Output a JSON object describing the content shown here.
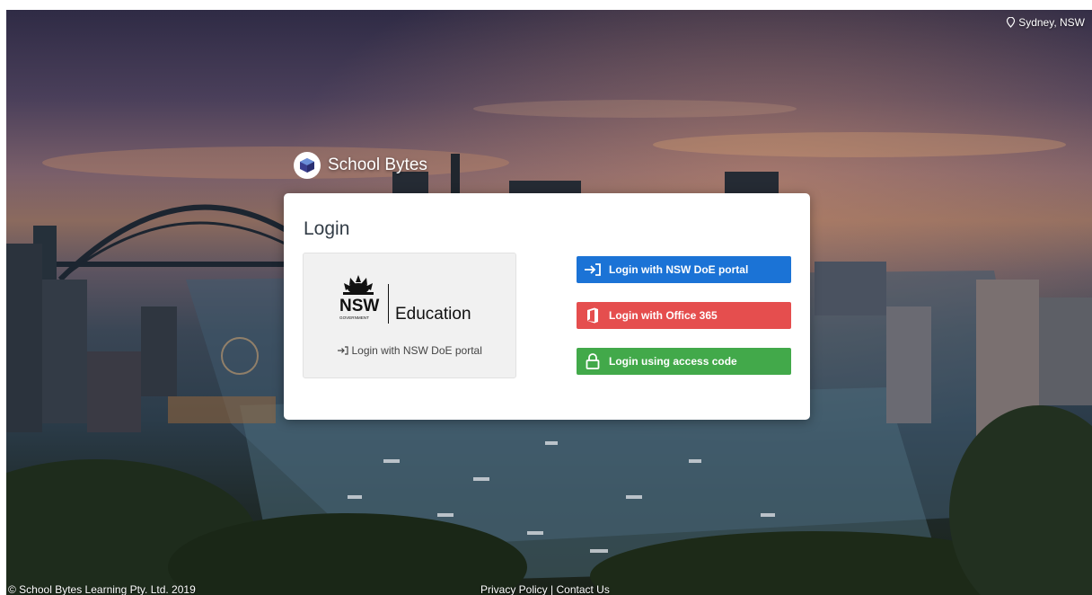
{
  "location": {
    "label": "Sydney, NSW",
    "icon": "location-pin-icon"
  },
  "brand": {
    "name": "School Bytes",
    "icon": "school-bytes-logo-icon"
  },
  "login": {
    "title": "Login",
    "nsw_card": {
      "logo_text_nsw": "NSW",
      "logo_text_government": "GOVERNMENT",
      "logo_text_education": "Education",
      "link_label": "Login with NSW DoE portal",
      "link_icon": "sign-in-icon"
    },
    "buttons": [
      {
        "label": "Login with NSW DoE portal",
        "icon": "sign-in-icon",
        "color": "#1b73d6"
      },
      {
        "label": "Login with Office 365",
        "icon": "office-365-icon",
        "color": "#e54e4e"
      },
      {
        "label": "Login using access code",
        "icon": "lock-icon",
        "color": "#42a94a"
      }
    ]
  },
  "footer": {
    "copyright": "© School Bytes Learning Pty. Ltd. 2019",
    "privacy": "Privacy Policy",
    "separator": " | ",
    "contact": "Contact Us"
  }
}
